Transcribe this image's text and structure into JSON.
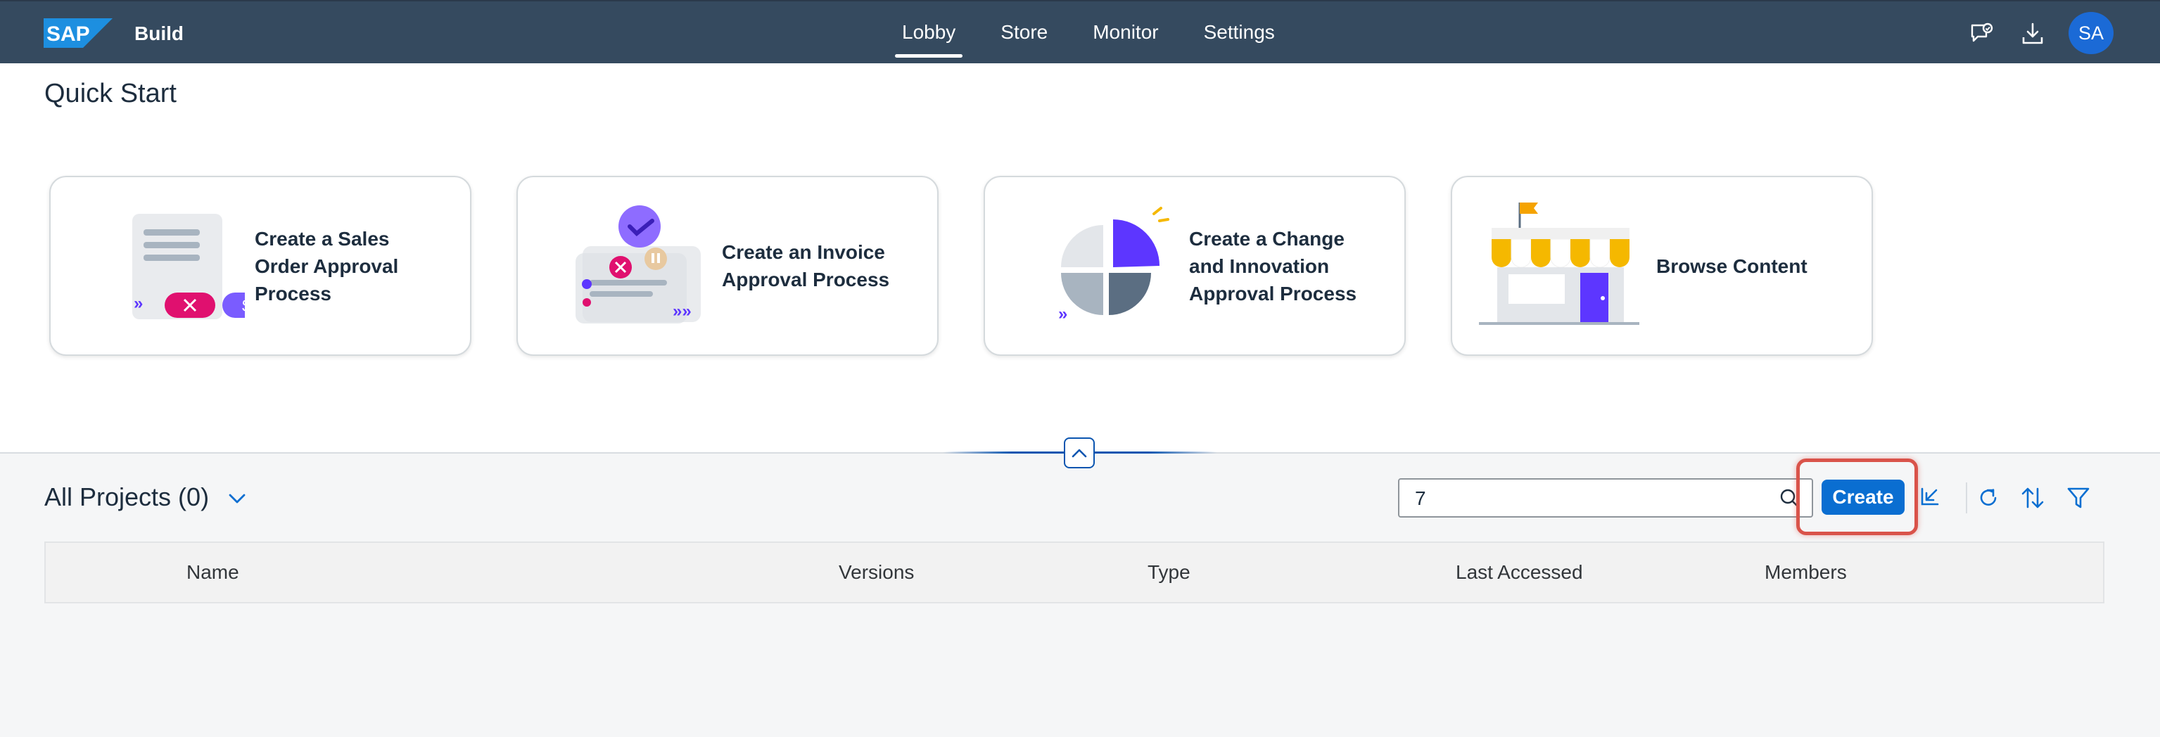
{
  "shellbar": {
    "logo_text": "SAP",
    "product": "Build",
    "nav": [
      {
        "label": "Lobby",
        "active": true
      },
      {
        "label": "Store",
        "active": false
      },
      {
        "label": "Monitor",
        "active": false
      },
      {
        "label": "Settings",
        "active": false
      }
    ],
    "actions": [
      "feedback-icon",
      "download-icon"
    ],
    "avatar_initials": "SA"
  },
  "quick_start": {
    "title": "Quick Start",
    "cards": [
      {
        "label": "Create a Sales Order Approval Process",
        "icon": "sales-order-illustration"
      },
      {
        "label": "Create an Invoice Approval Process",
        "icon": "invoice-illustration"
      },
      {
        "label": "Create a Change and Innovation Approval Process",
        "icon": "change-innovation-illustration"
      },
      {
        "label": "Browse Content",
        "icon": "store-illustration"
      }
    ]
  },
  "projects": {
    "title": "All Projects (0)",
    "search": {
      "value": "7",
      "placeholder": ""
    },
    "create_label": "Create",
    "toolbar_icons": [
      "import-icon",
      "refresh-icon",
      "sort-icon",
      "filter-icon"
    ],
    "columns": [
      "Name",
      "Versions",
      "Type",
      "Last Accessed",
      "Members"
    ],
    "rows": []
  },
  "colors": {
    "shellbar_bg": "#354a5f",
    "brand_blue": "#0a6ed1",
    "highlight": "#d9534a",
    "accent_purple": "#5d36ff",
    "accent_pink": "#e0106f"
  }
}
